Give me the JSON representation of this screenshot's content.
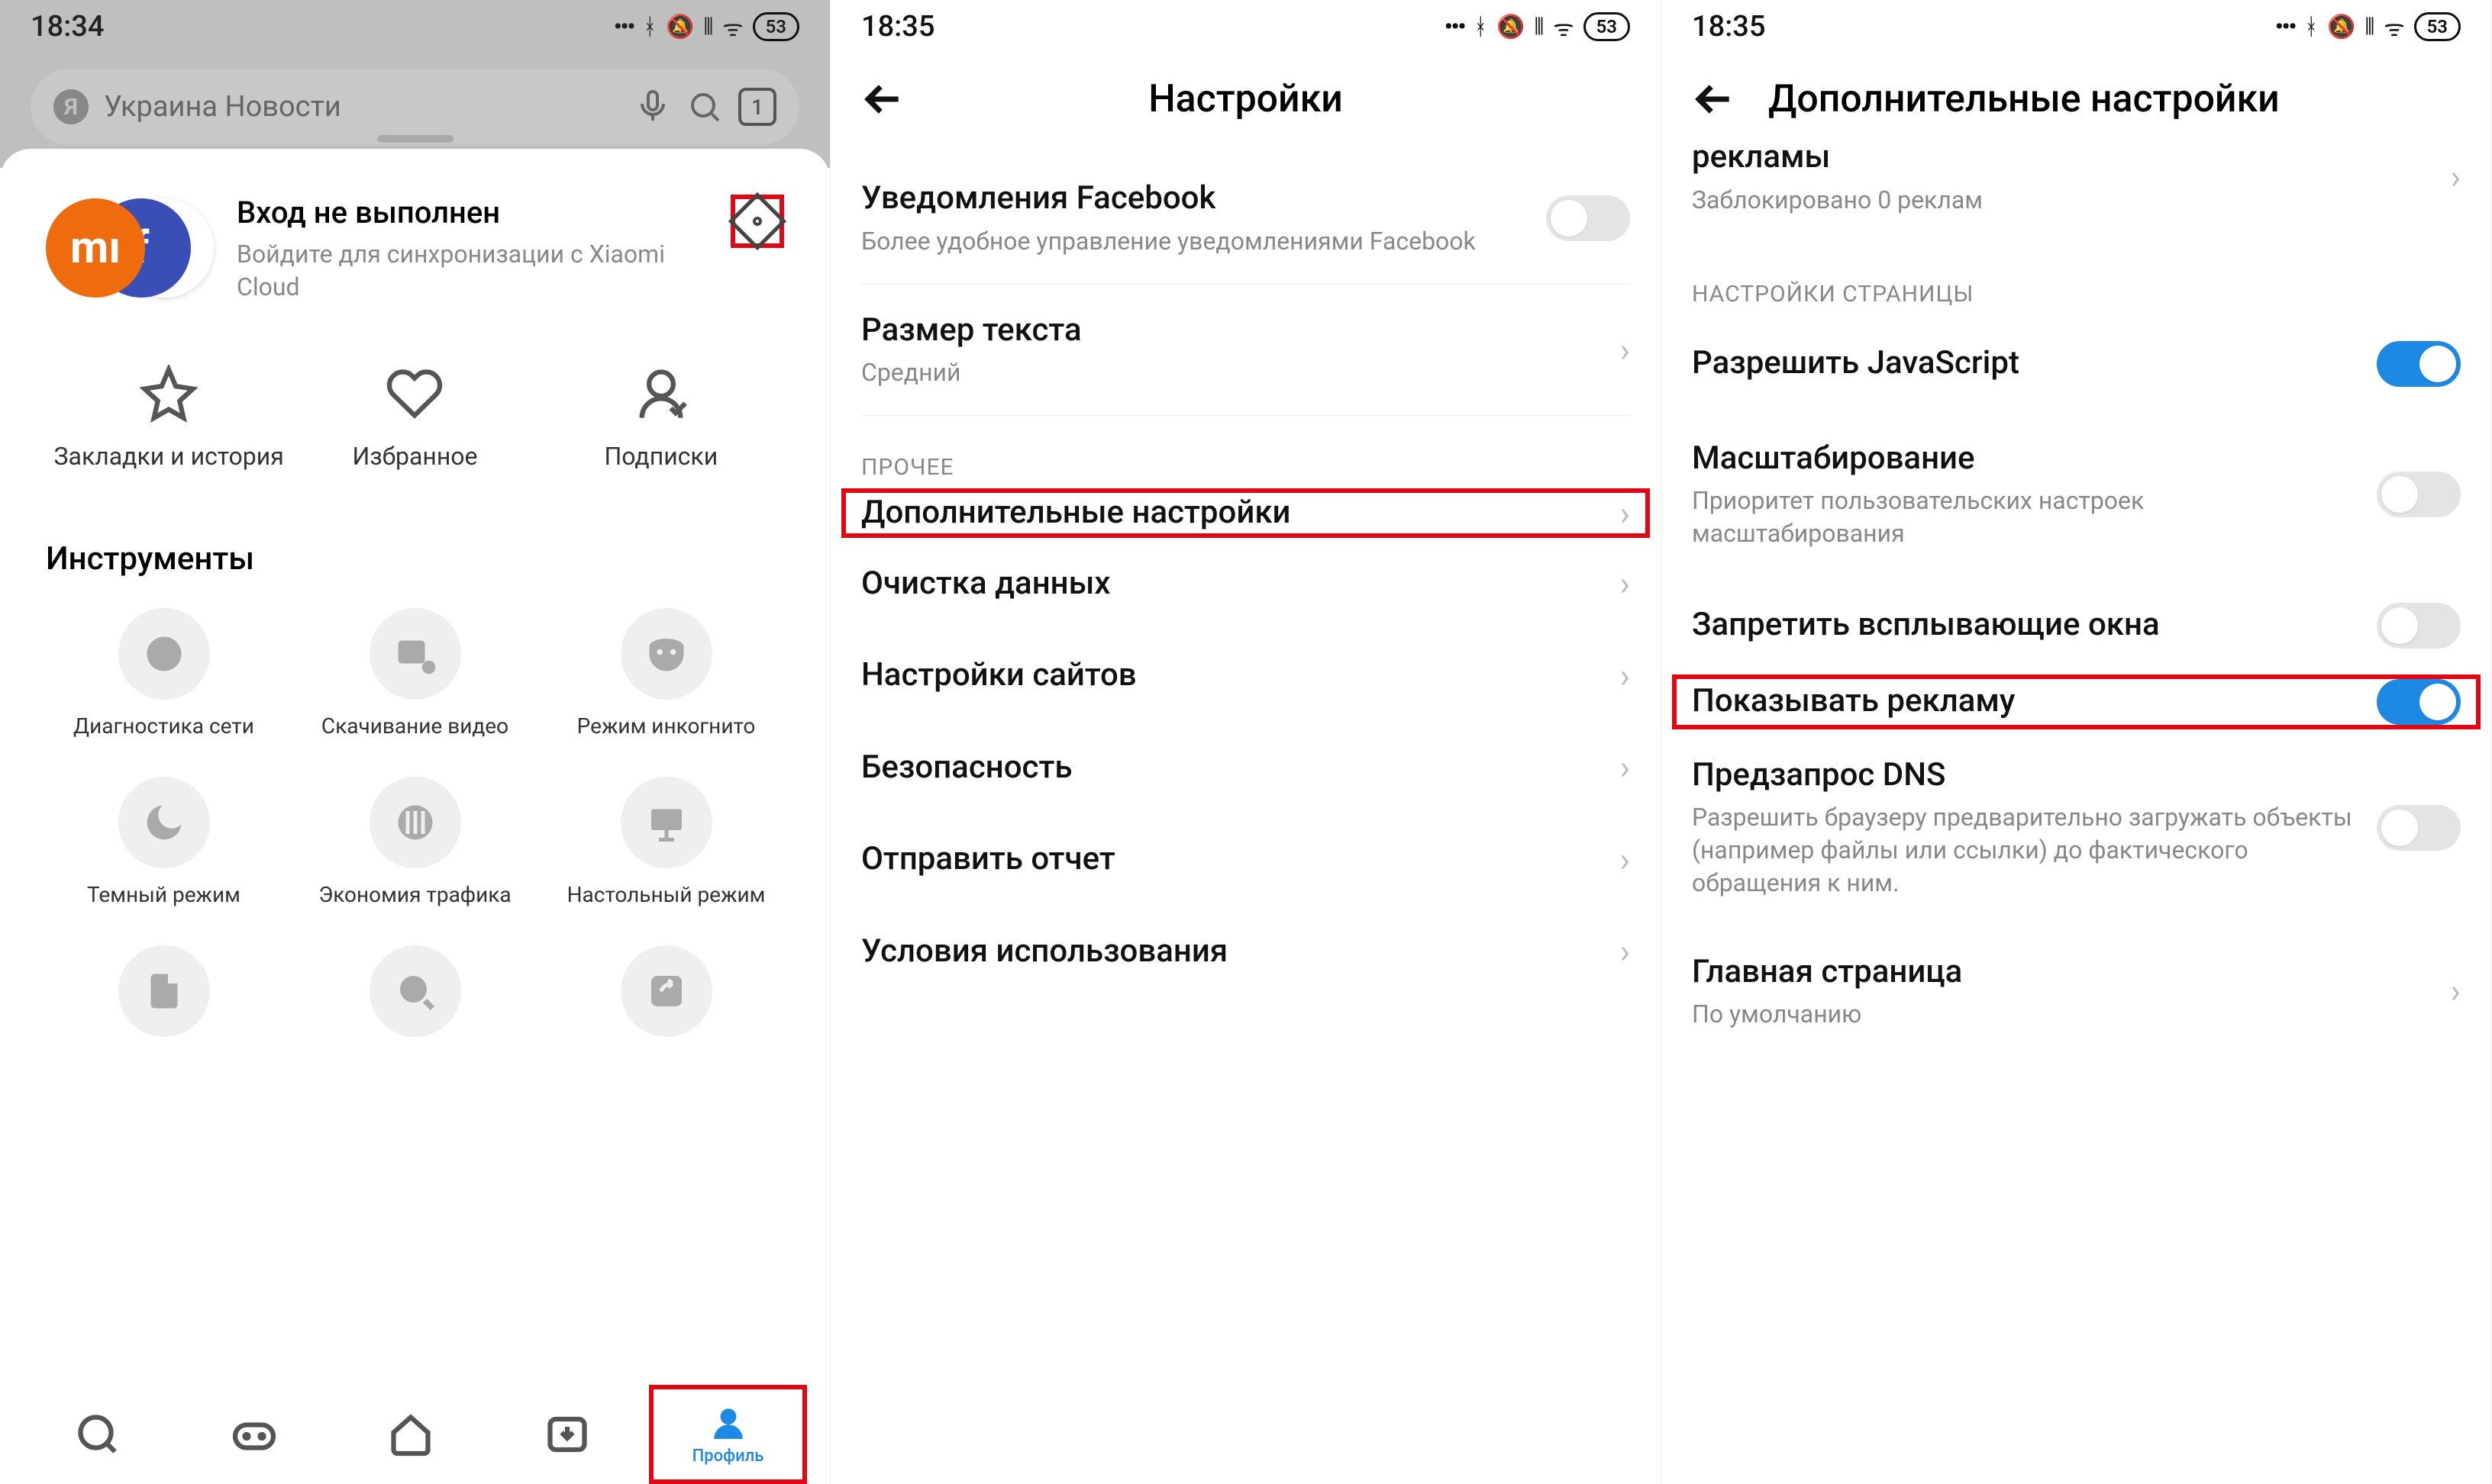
{
  "status": {
    "time1": "18:34",
    "time2": "18:35",
    "time3": "18:35",
    "batt": "53"
  },
  "s1": {
    "search_placeholder": "Украина Новости",
    "tab_count": "1",
    "login_title": "Вход не выполнен",
    "login_sub": "Войдите для синхронизации с Xiaomi Cloud",
    "quick": {
      "bookmarks": "Закладки и история",
      "favorite": "Избранное",
      "subscriptions": "Подписки"
    },
    "tools_header": "Инструменты",
    "tools": {
      "diag": "Диагностика сети",
      "dl": "Скачивание видео",
      "incog": "Режим инкогнито",
      "dark": "Темный режим",
      "save": "Экономия трафика",
      "desk": "Настольный режим"
    },
    "tab_profile": "Профиль"
  },
  "s2": {
    "title": "Настройки",
    "facebook_t": "Уведомления Facebook",
    "facebook_s": "Более удобное управление уведомлениями Facebook",
    "textsize_t": "Размер текста",
    "textsize_v": "Средний",
    "section_other": "ПРОЧЕЕ",
    "addl": "Дополнительные настройки",
    "clear": "Очистка данных",
    "sites": "Настройки сайтов",
    "security": "Безопасность",
    "report": "Отправить отчет",
    "terms": "Условия использования"
  },
  "s3": {
    "title": "Дополнительные настройки",
    "ads_t": "рекламы",
    "ads_s": "Заблокировано 0 реклам",
    "section_page": "НАСТРОЙКИ СТРАНИЦЫ",
    "js": "Разрешить JavaScript",
    "zoom_t": "Масштабирование",
    "zoom_s": "Приоритет пользовательских настроек масштабирования",
    "popup": "Запретить всплывающие окна",
    "showads": "Показывать рекламу",
    "dns_t": "Предзапрос DNS",
    "dns_s": "Разрешить браузеру предварительно загружать объекты (например файлы или ссылки) до фактического обращения к ним.",
    "home_t": "Главная страница",
    "home_s": "По умолчанию"
  }
}
